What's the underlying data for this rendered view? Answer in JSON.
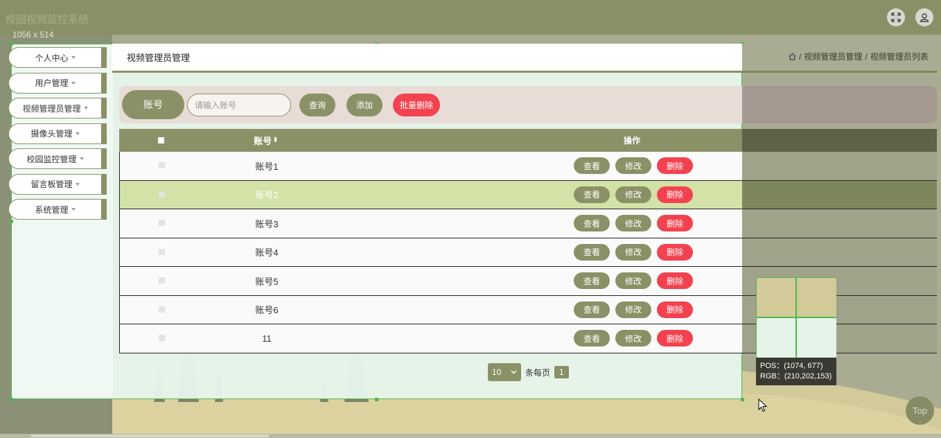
{
  "header": {
    "app_title": "校园视频监控系统",
    "size_label": "1056 x 514"
  },
  "sidebar": {
    "items": [
      {
        "label": "个人中心"
      },
      {
        "label": "用户管理"
      },
      {
        "label": "视频管理员管理"
      },
      {
        "label": "摄像头管理"
      },
      {
        "label": "校园监控管理"
      },
      {
        "label": "留言板管理"
      },
      {
        "label": "系统管理"
      }
    ]
  },
  "page": {
    "title": "视频管理员管理",
    "breadcrumb": [
      "视频管理员管理",
      "视频管理员列表"
    ],
    "breadcrumb_sep": "/"
  },
  "search": {
    "label": "账号",
    "placeholder": "请输入账号",
    "query_btn": "查询",
    "add_btn": "添加",
    "batch_delete_btn": "批量删除"
  },
  "table": {
    "columns": {
      "account": "账号",
      "sort_icon": "⬍",
      "actions": "操作"
    },
    "rows": [
      {
        "account": "账号1"
      },
      {
        "account": "账号2"
      },
      {
        "account": "账号3"
      },
      {
        "account": "账号4"
      },
      {
        "account": "账号5"
      },
      {
        "account": "账号6"
      },
      {
        "account": "11"
      }
    ],
    "actions": {
      "view": "查看",
      "edit": "修改",
      "delete": "删除"
    }
  },
  "pager": {
    "page_size": "10",
    "per_page_label": "条每页",
    "current_page": "1"
  },
  "picker": {
    "pos_line": "POS：(1074, 677)",
    "rgb_line": "RGB：(210,202,153)"
  },
  "top_button": "Top",
  "colors": {
    "primary": "#8b9166",
    "danger": "#f3424f",
    "selected_row": "#d3e2a6",
    "highlight_border": "#4fb74f"
  }
}
